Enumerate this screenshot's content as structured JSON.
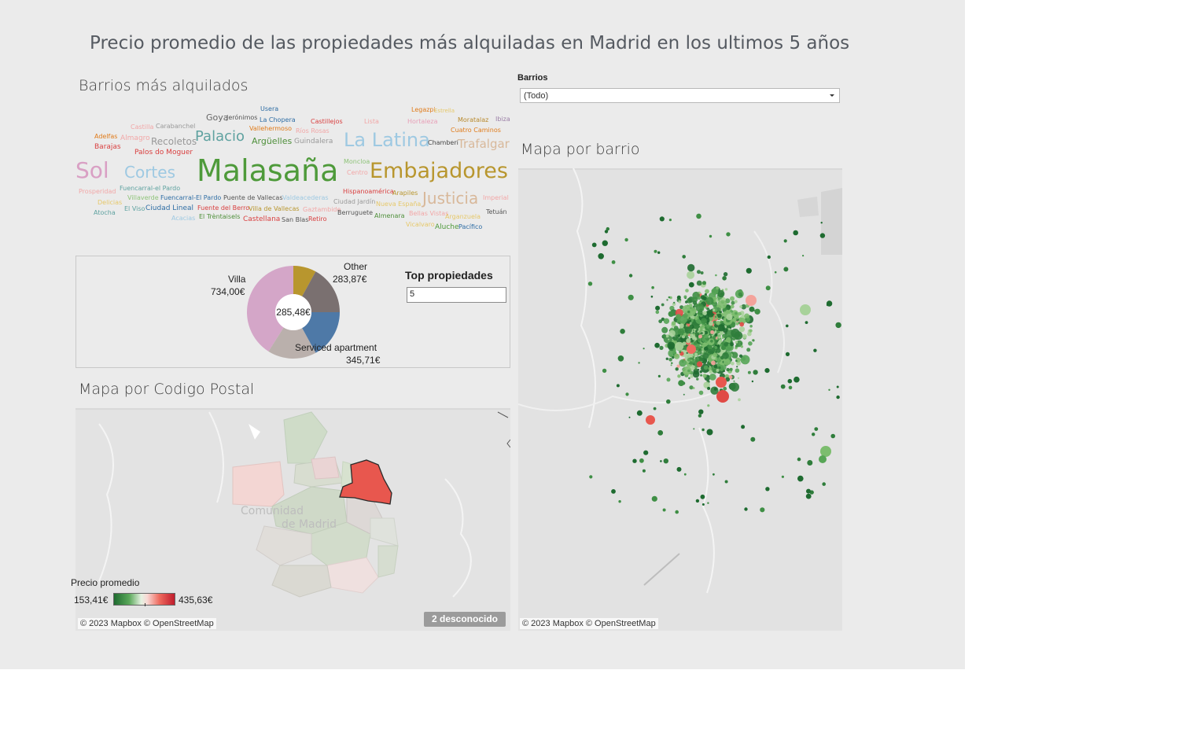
{
  "title": "Precio promedio de las propiedades  más alquiladas en Madrid en los ultimos 5 años",
  "sections": {
    "wordcloud_title": "Barrios más alquilados",
    "map_barrio_title": "Mapa por barrio",
    "map_postal_title": "Mapa por Codigo Postal"
  },
  "filter": {
    "label": "Barrios",
    "value": "(Todo)"
  },
  "wordcloud": [
    {
      "text": "Usera",
      "color": "#2e6da4"
    },
    {
      "text": "Legazpi",
      "color": "#e07b1a"
    },
    {
      "text": "Estrella",
      "color": "#e6c86a"
    },
    {
      "text": "Goya",
      "color": "#666666"
    },
    {
      "text": "Jerónimos",
      "color": "#555555"
    },
    {
      "text": "La Chopera",
      "color": "#2e6da4"
    },
    {
      "text": "Castillejos",
      "color": "#d94040"
    },
    {
      "text": "Lista",
      "color": "#f2a7a7"
    },
    {
      "text": "Hortaleza",
      "color": "#e8a0b8"
    },
    {
      "text": "Moratalaz",
      "color": "#b88a2e"
    },
    {
      "text": "Ibiza",
      "color": "#9b7fa6"
    },
    {
      "text": "Castilla",
      "color": "#f2a7a7"
    },
    {
      "text": "Carabanchel",
      "color": "#999999"
    },
    {
      "text": "Vallehermoso",
      "color": "#e07b1a"
    },
    {
      "text": "Ríos Rosas",
      "color": "#f2a7a7"
    },
    {
      "text": "Cuatro Caminos",
      "color": "#e07b1a"
    },
    {
      "text": "Adelfas",
      "color": "#e07b1a"
    },
    {
      "text": "Almagro",
      "color": "#f2a7a7"
    },
    {
      "text": "Recoletos",
      "color": "#999999"
    },
    {
      "text": "Palacio",
      "color": "#5fa2a0"
    },
    {
      "text": "Argüelles",
      "color": "#4e8f3a"
    },
    {
      "text": "Guindalera",
      "color": "#999999"
    },
    {
      "text": "La Latina",
      "color": "#9ec9e2"
    },
    {
      "text": "Chamberí",
      "color": "#444444"
    },
    {
      "text": "Trafalgar",
      "color": "#d8b89a"
    },
    {
      "text": "Barajas",
      "color": "#d94040"
    },
    {
      "text": "Palos do Moguer",
      "color": "#d94040"
    },
    {
      "text": "Sol",
      "color": "#d9a0c4"
    },
    {
      "text": "Cortes",
      "color": "#9ec9e2"
    },
    {
      "text": "Malasaña",
      "color": "#4e9a3a"
    },
    {
      "text": "Moncloa",
      "color": "#8fc47a"
    },
    {
      "text": "Centro",
      "color": "#f2a7a7"
    },
    {
      "text": "Embajadores",
      "color": "#b8962e"
    },
    {
      "text": "Prosperidad",
      "color": "#f2a7a7"
    },
    {
      "text": "Fuencarral-el Pardo",
      "color": "#5fa2a0"
    },
    {
      "text": "Hispanoamérica",
      "color": "#d94040"
    },
    {
      "text": "Arapiles",
      "color": "#b8962e"
    },
    {
      "text": "Justicia",
      "color": "#d8b89a"
    },
    {
      "text": "Imperial",
      "color": "#f2a7a7"
    },
    {
      "text": "Villaverde",
      "color": "#8fc47a"
    },
    {
      "text": "Fuencarral-El Pardo",
      "color": "#2e6da4"
    },
    {
      "text": "Puente de Vallecas",
      "color": "#555555"
    },
    {
      "text": "Valdeacederas",
      "color": "#9ec9e2"
    },
    {
      "text": "Ciudad Jardín",
      "color": "#999999"
    },
    {
      "text": "Nueva España",
      "color": "#e6c86a"
    },
    {
      "text": "Delicias",
      "color": "#e6c86a"
    },
    {
      "text": "El Viso",
      "color": "#5fa2a0"
    },
    {
      "text": "Ciudad Lineal",
      "color": "#2e6da4"
    },
    {
      "text": "Fuente del Berro",
      "color": "#d94040"
    },
    {
      "text": "Villa de Vallecas",
      "color": "#b8962e"
    },
    {
      "text": "Gaztambide",
      "color": "#f2a7a7"
    },
    {
      "text": "Berruguete",
      "color": "#555555"
    },
    {
      "text": "Almenara",
      "color": "#4e8f3a"
    },
    {
      "text": "Bellas Vistas",
      "color": "#f2a7a7"
    },
    {
      "text": "Arganzuela",
      "color": "#e6c86a"
    },
    {
      "text": "Tetuán",
      "color": "#555555"
    },
    {
      "text": "Atocha",
      "color": "#5fa2a0"
    },
    {
      "text": "Acacias",
      "color": "#9ec9e2"
    },
    {
      "text": "El Trèntaisels",
      "color": "#4e8f3a"
    },
    {
      "text": "Castellana",
      "color": "#d94040"
    },
    {
      "text": "San Blas",
      "color": "#555555"
    },
    {
      "text": "Retiro",
      "color": "#d94040"
    },
    {
      "text": "Vicalvaro",
      "color": "#e6c86a"
    },
    {
      "text": "Aluche",
      "color": "#4e9a3a"
    },
    {
      "text": "Pacífico",
      "color": "#2e6da4"
    }
  ],
  "chart_data": {
    "type": "pie",
    "donut": true,
    "center_label": "285,48€",
    "categories": [
      "Other",
      "Villa",
      "Serviced apartment"
    ],
    "values": [
      283.87,
      734.0,
      345.71
    ],
    "value_labels": [
      "283,87€",
      "734,00€",
      "345,71€"
    ],
    "colors": {
      "Other": "#7a7070",
      "Villa": "#d4a6c8",
      "Serviced apartment": "#4e79a7",
      "unlabeled_1": "#b8962e",
      "unlabeled_2": "#bab0ac"
    }
  },
  "top_properties": {
    "label": "Top  propiedades",
    "value": "5"
  },
  "legend": {
    "title": "Precio promedio",
    "min": "153,41€",
    "max": "435,63€",
    "colors": [
      "#1e6b30",
      "#5aa85a",
      "#e6f2e2",
      "#f8d8d4",
      "#ee6a5e",
      "#c01c2c"
    ]
  },
  "map_postal": {
    "region_label_1": "Comunidad",
    "region_label_2": "de Madrid",
    "unknown_badge": "2 desconocido",
    "attribution": "© 2023 Mapbox © OpenStreetMap"
  },
  "map_barrio": {
    "attribution": "© 2023 Mapbox © OpenStreetMap"
  }
}
